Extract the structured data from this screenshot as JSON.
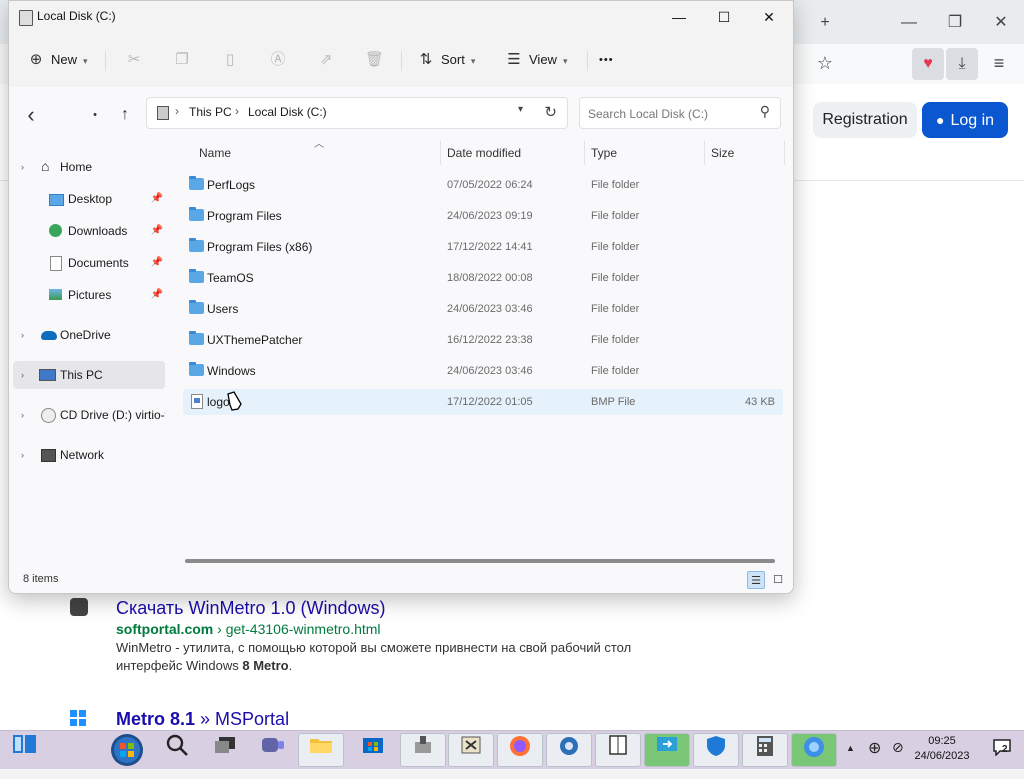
{
  "browser": {
    "new_tab": "+",
    "controls": {
      "minimize": "—",
      "restore": "❐",
      "close": "✕"
    },
    "toolbar": {
      "bookmark": "☆",
      "pocket": "♥",
      "downloads": "⤓",
      "menu": "≡"
    },
    "header": {
      "registration": "Registration",
      "login": "Log in",
      "login_icon": "person-icon"
    },
    "results": [
      {
        "title": "Скачать WinMetro 1.0 (Windows)",
        "url_domain": "softportal.com",
        "url_sep": "›",
        "url_path": "get-43106-winmetro.html",
        "snippet_pre": "WinMetro - утилита, с помощью которой вы сможете привнести на свой рабочий стол интерфейс Windows ",
        "snippet_bold": "8 Metro",
        "snippet_post": "."
      },
      {
        "title_bold": "Metro 8.1",
        "title_rest": " » MSPortal"
      }
    ]
  },
  "explorer": {
    "title": "Local Disk (C:)",
    "controls": {
      "minimize": "—",
      "maximize": "☐",
      "close": "✕"
    },
    "commands": {
      "new": "New",
      "sort": "Sort",
      "view": "View",
      "more": "•••"
    },
    "nav": {
      "back": "‹",
      "forward": "•",
      "up": "↑"
    },
    "address": {
      "crumbs": [
        "This PC",
        "Local Disk (C:)"
      ],
      "sep": "›"
    },
    "search": {
      "placeholder": "Search Local Disk (C:)"
    },
    "columns": {
      "name": "Name",
      "date": "Date modified",
      "type": "Type",
      "size": "Size"
    },
    "sidebar": [
      {
        "label": "Home",
        "icon": "home-icon",
        "expand": "›"
      },
      {
        "label": "Desktop",
        "icon": "desktop-icon",
        "pinned": true
      },
      {
        "label": "Downloads",
        "icon": "downloads-icon",
        "pinned": true
      },
      {
        "label": "Documents",
        "icon": "documents-icon",
        "pinned": true
      },
      {
        "label": "Pictures",
        "icon": "pictures-icon",
        "pinned": true
      },
      {
        "label": "OneDrive",
        "icon": "onedrive-icon",
        "expand": "›"
      },
      {
        "label": "This PC",
        "icon": "this-pc-icon",
        "expand": "›",
        "selected": true
      },
      {
        "label": "CD Drive (D:) virtio-win",
        "icon": "cd-drive-icon",
        "expand": "›"
      },
      {
        "label": "Network",
        "icon": "network-icon",
        "expand": "›"
      }
    ],
    "files": [
      {
        "name": "PerfLogs",
        "date": "07/05/2022 06:24",
        "type": "File folder",
        "size": ""
      },
      {
        "name": "Program Files",
        "date": "24/06/2023 09:19",
        "type": "File folder",
        "size": ""
      },
      {
        "name": "Program Files (x86)",
        "date": "17/12/2022 14:41",
        "type": "File folder",
        "size": ""
      },
      {
        "name": "TeamOS",
        "date": "18/08/2022 00:08",
        "type": "File folder",
        "size": ""
      },
      {
        "name": "Users",
        "date": "24/06/2023 03:46",
        "type": "File folder",
        "size": ""
      },
      {
        "name": "UXThemePatcher",
        "date": "16/12/2022 23:38",
        "type": "File folder",
        "size": ""
      },
      {
        "name": "Windows",
        "date": "24/06/2023 03:46",
        "type": "File folder",
        "size": ""
      },
      {
        "name": "logo",
        "date": "17/12/2022 01:05",
        "type": "BMP File",
        "size": "43 KB"
      }
    ],
    "status": {
      "count": "8 items"
    }
  },
  "taskbar": {
    "clock_time": "09:25",
    "clock_date": "24/06/2023",
    "notifications": "2",
    "tray_arrow": "▲"
  }
}
